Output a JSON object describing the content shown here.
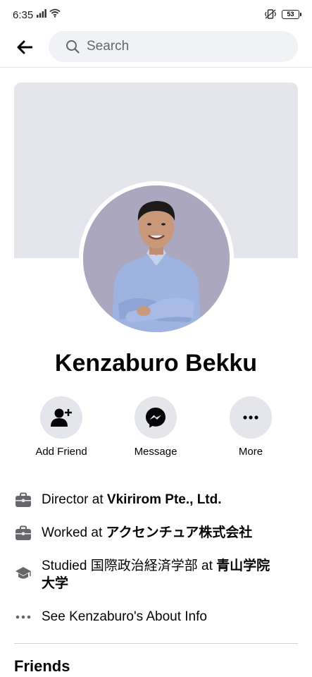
{
  "status_bar": {
    "time": "6:35",
    "battery": "53",
    "icons": [
      "signal-icon",
      "wifi-icon",
      "vibrate-icon",
      "battery-icon"
    ]
  },
  "search": {
    "placeholder": "Search"
  },
  "profile": {
    "name": "Kenzaburo Bekku"
  },
  "actions": [
    {
      "label": "Add Friend",
      "icon": "add-friend-icon"
    },
    {
      "label": "Message",
      "icon": "messenger-icon"
    },
    {
      "label": "More",
      "icon": "more-icon"
    }
  ],
  "about": {
    "work_current": {
      "prefix": "Director at ",
      "place": "Vkirirom Pte., Ltd.",
      "icon": "briefcase-icon"
    },
    "work_past": {
      "prefix": "Worked at ",
      "place": "アクセンチュア株式会社",
      "icon": "briefcase-icon"
    },
    "education": {
      "prefix": "Studied ",
      "field": "国際政治経済学部",
      "middle": " at ",
      "school": "青山学院大学",
      "icon": "graduation-cap-icon"
    },
    "see_about": {
      "label": "See Kenzaburo's About Info",
      "icon": "more-dots-icon"
    }
  },
  "sections": {
    "friends_title": "Friends"
  },
  "colors": {
    "accent_text": "#050505",
    "secondary_text": "#65676b",
    "button_bg": "#e4e6eb",
    "search_bg": "#f0f2f5",
    "cover_bg": "#e4e6eb"
  }
}
